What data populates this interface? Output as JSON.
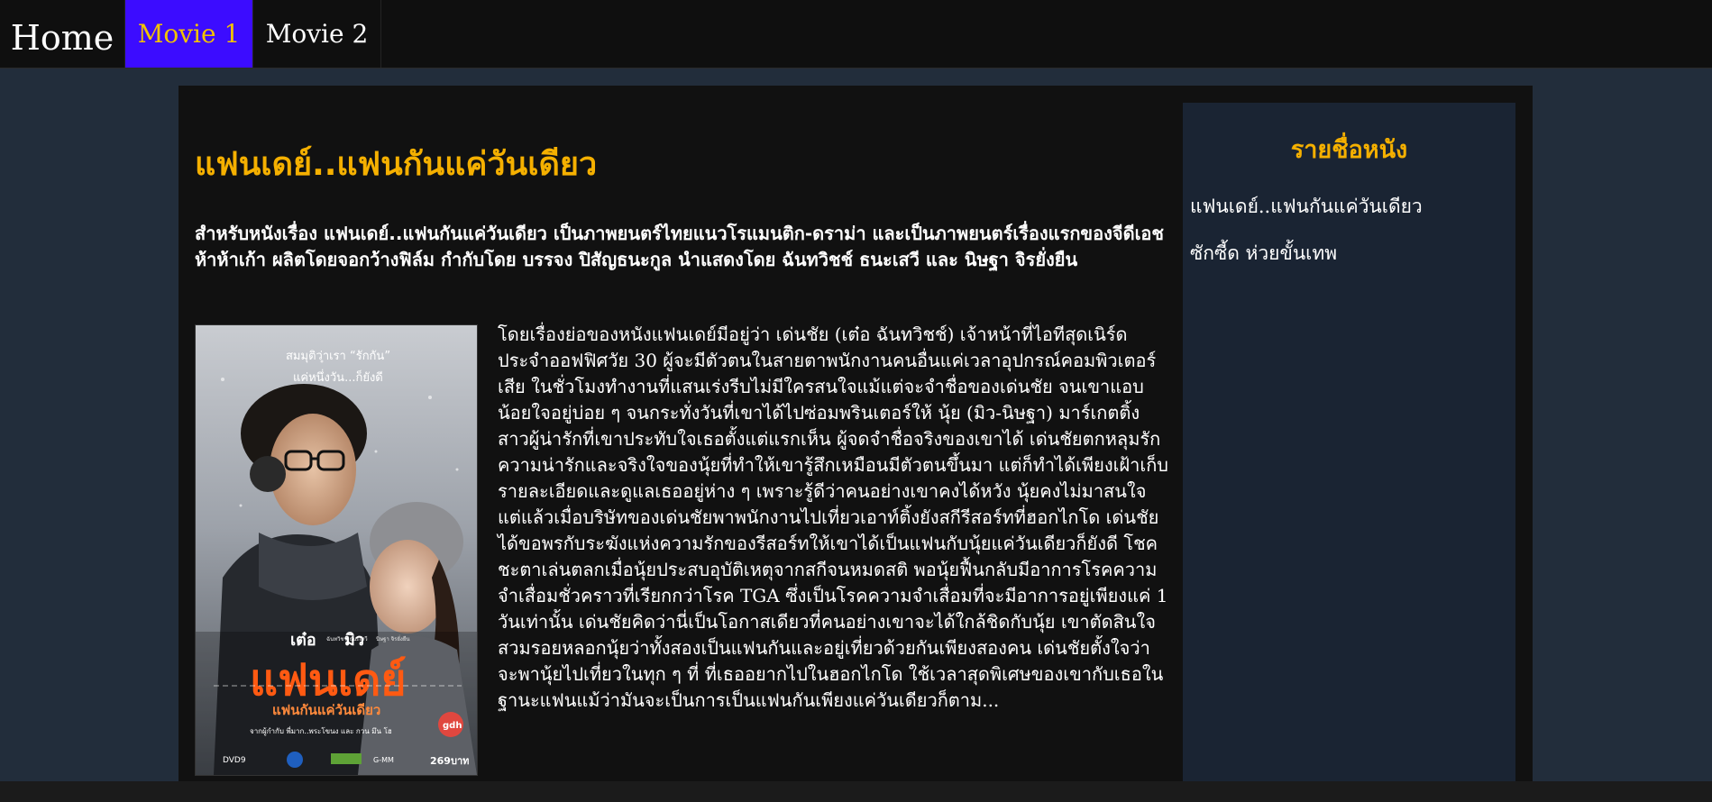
{
  "nav": {
    "home": "Home",
    "movie1": "Movie 1",
    "movie2": "Movie 2"
  },
  "main": {
    "title": "แฟนเดย์..แฟนกันแค่วันเดียว",
    "intro": "สำหรับหนังเรื่อง แฟนเดย์..แฟนกันแค่วันเดียว เป็นภาพยนตร์ไทยแนวโรแมนติก-ดราม่า และเป็นภาพยนตร์เรื่องแรกของจีดีเอช ห้าห้าเก้า ผลิตโดยจอกว้างฟิล์ม กำกับโดย บรรจง ปิสัญธนะกูล นำแสดงโดย ฉันทวิชช์ ธนะเสวี และ นิษฐา จิรยั่งยืน",
    "story": "โดยเรื่องย่อของหนังแฟนเดย์มีอยู่ว่า เด่นชัย (เต๋อ ฉันทวิชช์) เจ้าหน้าที่ไอทีสุดเนิร์ดประจำออฟฟิศวัย 30 ผู้จะมีตัวตนในสายตาพนักงานคนอื่นแค่เวลาอุปกรณ์คอมพิวเตอร์เสีย ในชั่วโมงทำงานที่แสนเร่งรีบไม่มีใครสนใจแม้แต่จะจำชื่อของเด่นชัย จนเขาแอบน้อยใจอยู่บ่อย ๆ จนกระทั่งวันที่เขาได้ไปซ่อมพรินเตอร์ให้ นุ้ย (มิว-นิษฐา) มาร์เกตติ้งสาวผู้น่ารักที่เขาประทับใจเธอตั้งแต่แรกเห็น ผู้จดจำชื่อจริงของเขาได้ เด่นชัยตกหลุมรักความน่ารักและจริงใจของนุ้ยที่ทำให้เขารู้สึกเหมือนมีตัวตนขึ้นมา แต่ก็ทำได้เพียงเฝ้าเก็บรายละเอียดและดูแลเธออยู่ห่าง ๆ เพราะรู้ดีว่าคนอย่างเขาคงได้หวัง นุ้ยคงไม่มาสนใจ แต่แล้วเมื่อบริษัทของเด่นชัยพาพนักงานไปเที่ยวเอาท์ติ้งยังสกีรีสอร์ทที่ฮอกไกโด เด่นชัยได้ขอพรกับระฆังแห่งความรักของรีสอร์ทให้เขาได้เป็นแฟนกับนุ้ยแค่วันเดียวก็ยังดี โชคชะตาเล่นตลกเมื่อนุ้ยประสบอุบัติเหตุจากสกีจนหมดสติ พอนุ้ยฟื้นกลับมีอาการโรคความจำเสื่อมชั่วคราวที่เรียกกว่าโรค TGA ซึ่งเป็นโรคความจำเสื่อมที่จะมีอาการอยู่เพียงแค่ 1 วันเท่านั้น เด่นชัยคิดว่านี่เป็นโอกาสเดียวที่คนอย่างเขาจะได้ใกล้ชิดกับนุ้ย เขาตัดสินใจสวมรอยหลอกนุ้ยว่าทั้งสองเป็นแฟนกันและอยู่เที่ยวด้วยกันเพียงสองคน เด่นชัยตั้งใจว่าจะพานุ้ยไปเที่ยวในทุก ๆ ที่ ที่เธออยากไปในฮอกไกโด ใช้เวลาสุดพิเศษของเขากับเธอในฐานะแฟนแม้ว่ามันจะเป็นการเป็นแฟนกันเพียงแค่วันเดียวก็ตาม..."
  },
  "poster": {
    "tagline_line1": "สมมุติว่าเรา “รักกัน”",
    "tagline_line2": "แค่หนึ่งวัน...ก็ยังดี",
    "actor1": "เต๋อ",
    "actor1_full": "ฉันทวิชช์ ธนะเสวี",
    "actor2": "มิว",
    "actor2_full": "นิษฐา จิรยั่งยืน",
    "movie_title": "แฟนเดย์",
    "movie_subtitle": "แฟนกันแค่วันเดียว",
    "credit": "จากผู้กำกับ พี่มาก..พระโขนง และ กวน มึน โฮ",
    "price": "269บาท",
    "studio_badge": "gdh",
    "logo_dvd": "DVD9",
    "logo_gmm": "G-MM"
  },
  "sidebar": {
    "title": "รายชื่อหนัง",
    "links": [
      "แฟนเดย์..แฟนกันแค่วันเดียว",
      "ซักซี้ด ห่วยขั้นเทพ"
    ]
  },
  "colors": {
    "accent": "#f5b000",
    "active_tab": "#3c0cff",
    "page_bg": "#222d3b",
    "content_bg": "#111111",
    "sidebar_bg": "#1a2433"
  }
}
